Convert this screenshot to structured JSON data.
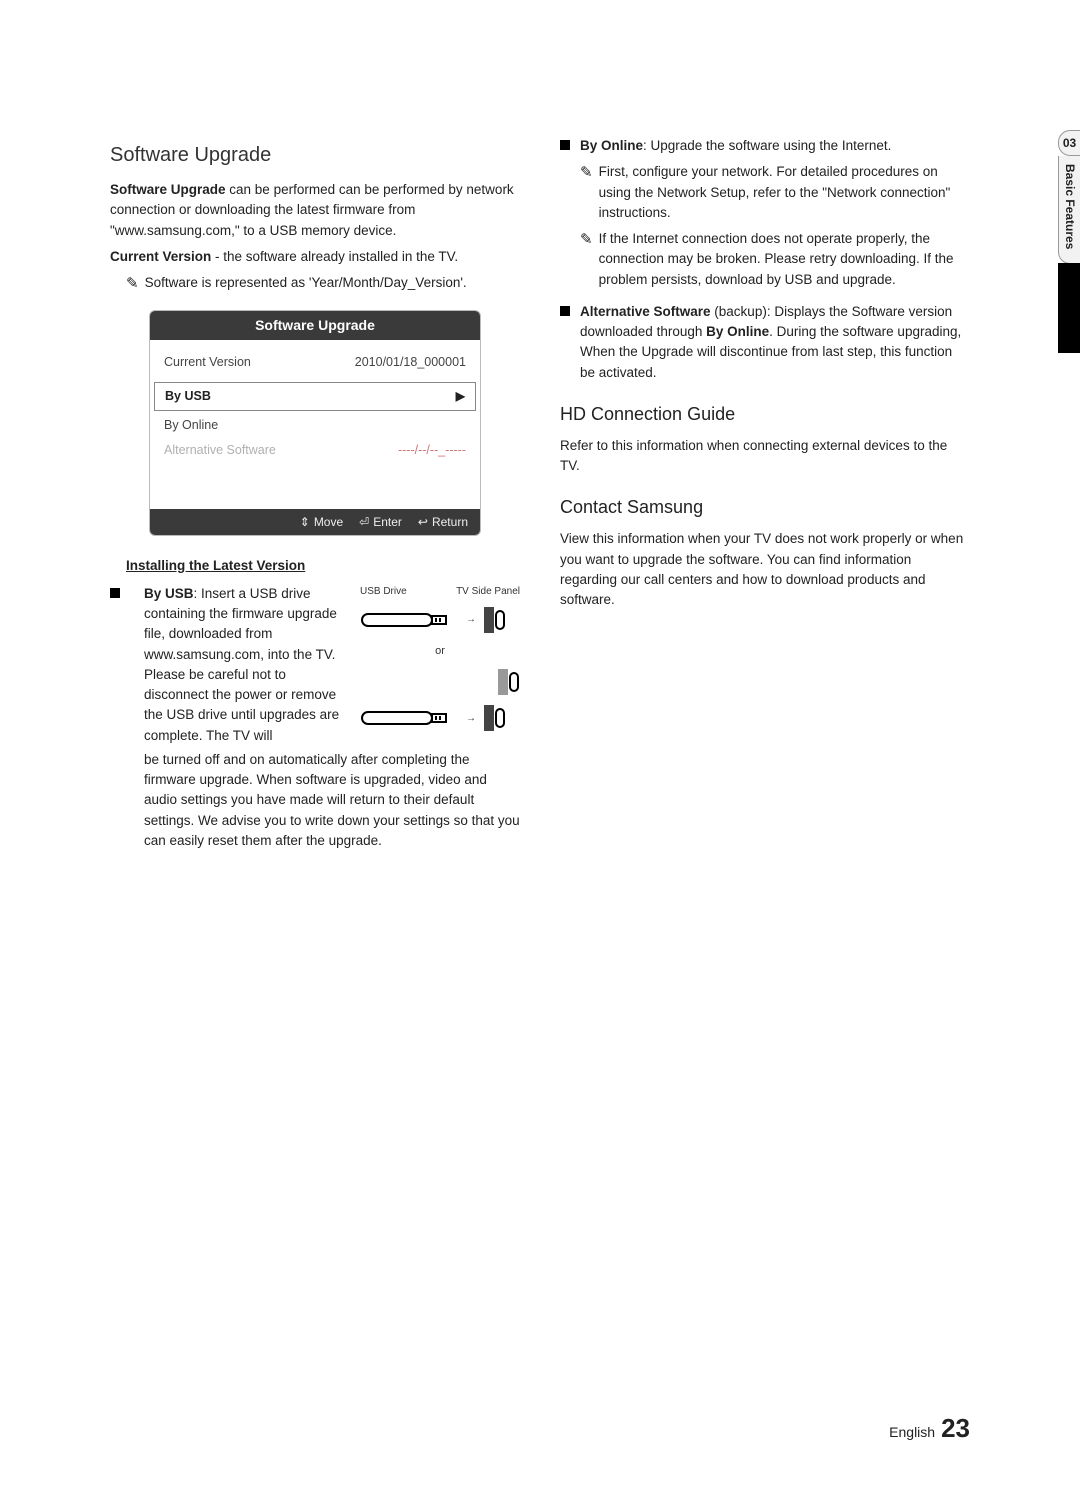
{
  "side": {
    "num": "03",
    "label": "Basic Features"
  },
  "left": {
    "h_software_upgrade": "Software Upgrade",
    "p_software_upgrade": "can be performed can be performed by network connection or downloading the latest firmware from \"www.samsung.com,\" to a USB memory device.",
    "bold_software_upgrade": "Software Upgrade ",
    "bold_current_version": "Current Version",
    "p_current_version": " - the software already installed in the TV.",
    "p_note_format": "Software is represented as 'Year/Month/Day_Version'.",
    "panel": {
      "title": "Software Upgrade",
      "cur_label": "Current Version",
      "cur_value": "2010/01/18_000001",
      "byusb": "By USB",
      "byonline": "By Online",
      "alt_label": "Alternative Software",
      "alt_value": "----/--/--_-----",
      "move": "Move",
      "enter": "Enter",
      "return": "Return"
    },
    "sub_installing": "Installing the Latest Version",
    "byusb_bold": "By USB",
    "byusb_text1": ": Insert a USB drive containing the firmware upgrade file, downloaded from www.samsung.com, into the TV. Please be careful not to disconnect the power or remove the USB drive until upgrades are complete. The TV will",
    "byusb_text2": "be turned off and on automatically after completing the firmware upgrade. When software is upgraded, video and audio settings you have made will return to their default settings. We advise you to write down your settings so that you can easily reset them after the upgrade.",
    "diag": {
      "usbdrive": "USB Drive",
      "tvside": "TV Side Panel",
      "or": "or"
    }
  },
  "right": {
    "byonline_bold": "By Online",
    "byonline_text": ": Upgrade the software using the Internet.",
    "online_note1": "First, configure your network. For detailed procedures on using the Network Setup, refer to the \"Network connection\" instructions.",
    "online_note2": "If the Internet connection does not operate properly, the connection may be broken. Please retry downloading. If the problem persists, download by USB and upgrade.",
    "alt_bold": "Alternative Software",
    "alt_text1": " (backup): Displays the Software version downloaded through ",
    "alt_bold2": "By Online",
    "alt_text2": ". During the software upgrading, When the Upgrade will discontinue from last step, this function be activated.",
    "h_hd": "HD Connection Guide",
    "p_hd": "Refer to this information when connecting external devices to the TV.",
    "h_contact": "Contact Samsung",
    "p_contact": "View this information when your TV does not work properly or when you want to upgrade the software. You can find information regarding our call centers and how to download products and software."
  },
  "footer": {
    "lang": "English",
    "page": "23"
  },
  "chart_data": {
    "type": "table",
    "title": "Software Upgrade",
    "rows": [
      {
        "label": "Current Version",
        "value": "2010/01/18_000001"
      },
      {
        "label": "By USB",
        "value": "▶"
      },
      {
        "label": "By Online",
        "value": ""
      },
      {
        "label": "Alternative Software",
        "value": "----/--/--_-----"
      }
    ],
    "footer_actions": [
      "Move",
      "Enter",
      "Return"
    ]
  }
}
